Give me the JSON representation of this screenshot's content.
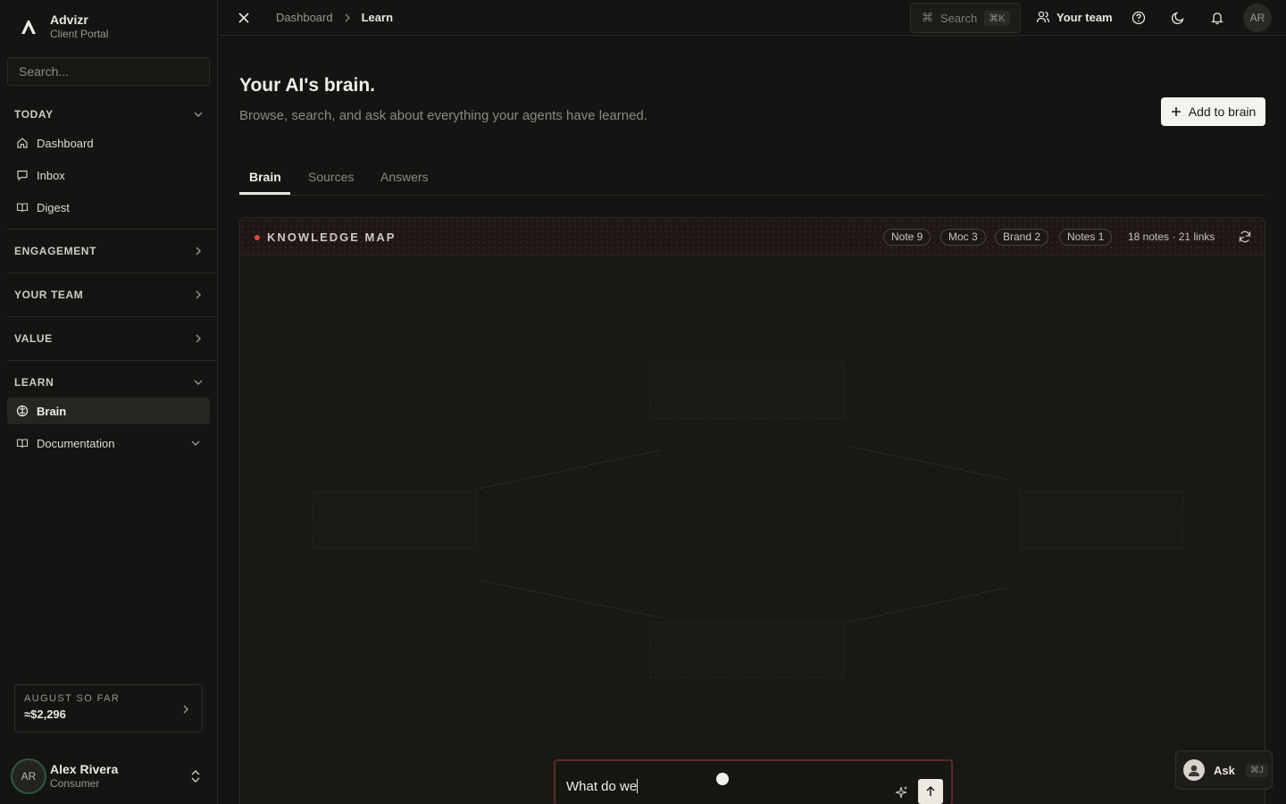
{
  "brand": {
    "name": "Advizr",
    "subtitle": "Client Portal"
  },
  "sidebar": {
    "search_placeholder": "Search...",
    "sections": {
      "today": "TODAY",
      "engagement": "ENGAGEMENT",
      "your_team": "YOUR TEAM",
      "value": "VALUE",
      "learn": "LEARN"
    },
    "items": {
      "dashboard": "Dashboard",
      "inbox": "Inbox",
      "digest": "Digest",
      "brain": "Brain",
      "documentation": "Documentation"
    },
    "month_card": {
      "label": "AUGUST SO FAR",
      "value": "≈$2,296"
    },
    "user": {
      "initials": "AR",
      "name": "Alex Rivera",
      "role": "Consumer"
    }
  },
  "topbar": {
    "breadcrumbs": [
      "Dashboard",
      "Learn"
    ],
    "search_label": "Search",
    "search_shortcut": "⌘K",
    "team_label": "Your team",
    "avatar_initials": "AR"
  },
  "main": {
    "title": "Your AI's brain.",
    "subtitle": "Browse, search, and ask about everything your agents have learned.",
    "add_button": "Add to brain",
    "tabs": [
      "Brain",
      "Sources",
      "Answers"
    ],
    "active_tab": "Brain"
  },
  "knowledge_map": {
    "title": "KNOWLEDGE MAP",
    "chips": [
      "Note 9",
      "Moc 3",
      "Brand 2",
      "Notes 1"
    ],
    "stats": "18 notes · 21 links",
    "accent_color": "#e0463a"
  },
  "ask_input": {
    "value": "What do we"
  },
  "ask_fab": {
    "label": "Ask",
    "shortcut": "⌘J"
  }
}
